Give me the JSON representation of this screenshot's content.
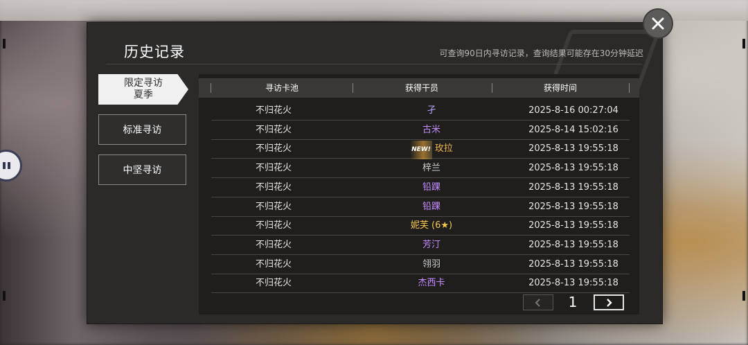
{
  "header": {
    "title": "历史记录",
    "notice": "可查询90日内寻访记录，查询结果可能存在30分钟延迟"
  },
  "tabs": [
    {
      "label": "限定寻访\n夏季",
      "line1": "限定寻访",
      "line2": "夏季",
      "active": true
    },
    {
      "label": "标准寻访",
      "active": false
    },
    {
      "label": "中坚寻访",
      "active": false
    }
  ],
  "table": {
    "columns": [
      "寻访卡池",
      "获得干员",
      "获得时间"
    ],
    "rows": [
      {
        "pool": "不归花火",
        "operator": "孑",
        "time": "2025-8-16 00:27:04",
        "color": "#b7a8ff",
        "new": false
      },
      {
        "pool": "不归花火",
        "operator": "古米",
        "time": "2025-8-14 15:02:16",
        "color": "#c48cff",
        "new": false
      },
      {
        "pool": "不归花火",
        "operator": "玫拉",
        "time": "2025-8-13 19:55:18",
        "color": "#f0b54a",
        "new": true,
        "new_label": "NEW!"
      },
      {
        "pool": "不归花火",
        "operator": "梓兰",
        "time": "2025-8-13 19:55:18",
        "color": "#cfcfcf",
        "new": false
      },
      {
        "pool": "不归花火",
        "operator": "铅踝",
        "time": "2025-8-13 19:55:18",
        "color": "#c48cff",
        "new": false
      },
      {
        "pool": "不归花火",
        "operator": "铅踝",
        "time": "2025-8-13 19:55:18",
        "color": "#c48cff",
        "new": false
      },
      {
        "pool": "不归花火",
        "operator": "妮芙 (6★)",
        "time": "2025-8-13 19:55:18",
        "color": "#f5c84a",
        "new": false
      },
      {
        "pool": "不归花火",
        "operator": "芳汀",
        "time": "2025-8-13 19:55:18",
        "color": "#c48cff",
        "new": false
      },
      {
        "pool": "不归花火",
        "operator": "翎羽",
        "time": "2025-8-13 19:55:18",
        "color": "#cfcfcf",
        "new": false
      },
      {
        "pool": "不归花火",
        "operator": "杰西卡",
        "time": "2025-8-13 19:55:18",
        "color": "#c48cff",
        "new": false
      }
    ]
  },
  "pagination": {
    "current": "1",
    "prev_icon": "chevron-left-icon",
    "next_icon": "chevron-right-icon"
  },
  "icons": {
    "close": "close-icon"
  }
}
